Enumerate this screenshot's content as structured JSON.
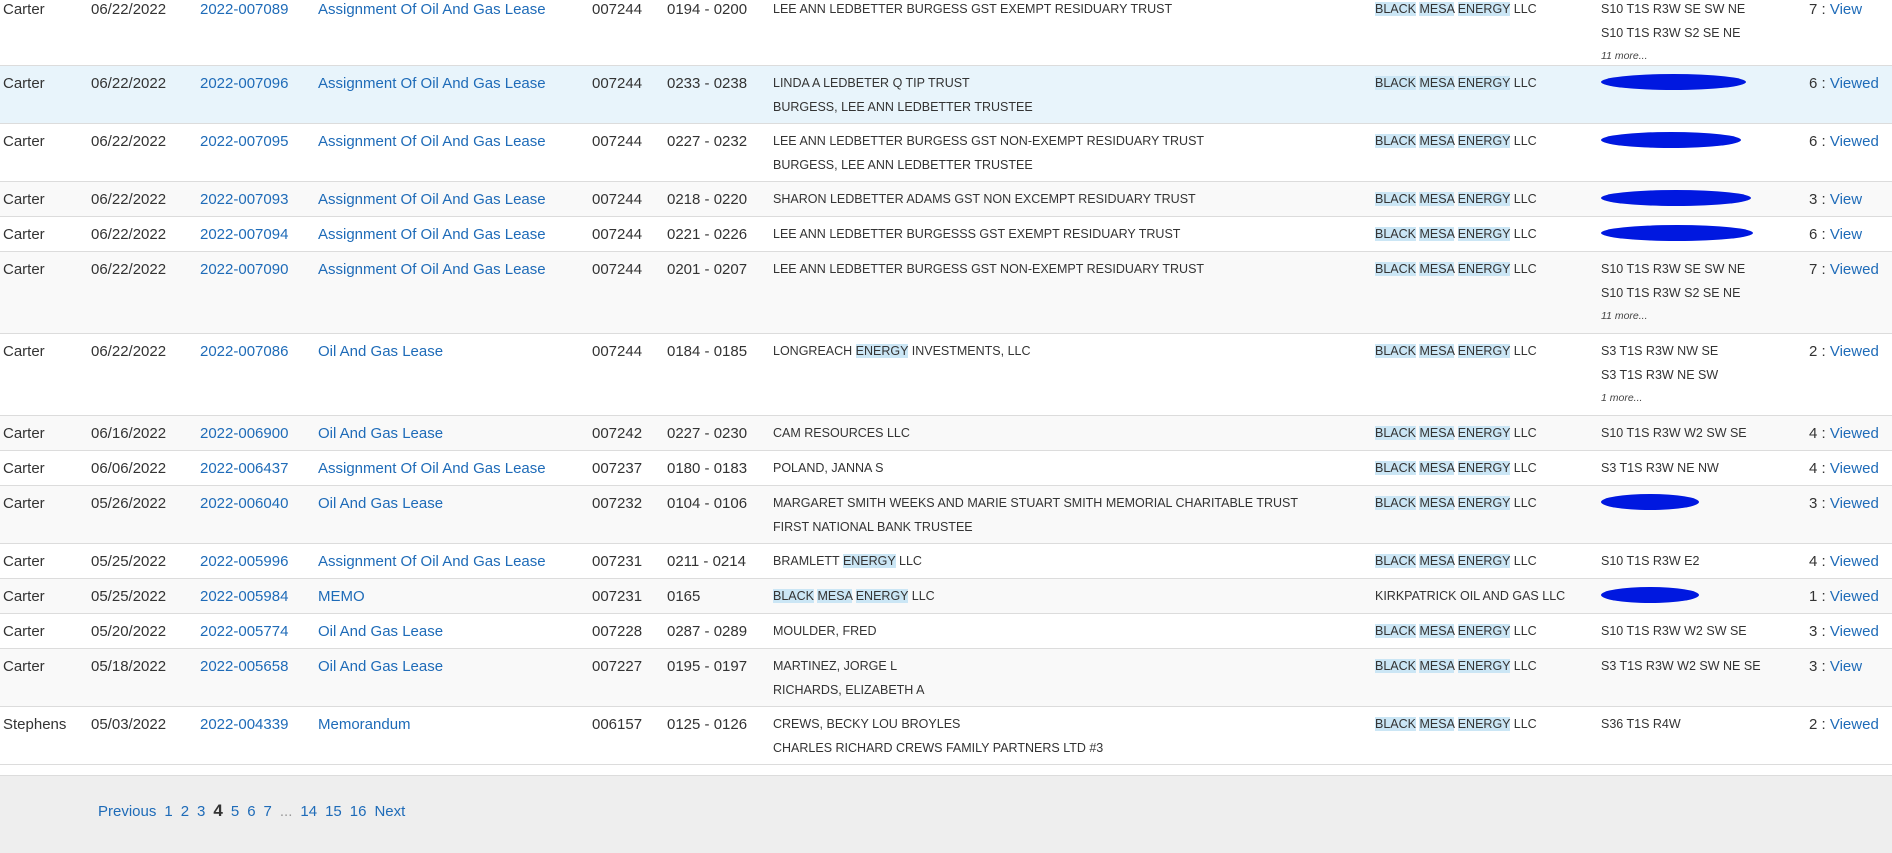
{
  "rows": [
    {
      "county": "Carter",
      "date": "06/22/2022",
      "doc": "2022-007089",
      "type": "Assignment Of Oil And Gas Lease",
      "book": "007244",
      "pages": "0194 - 0200",
      "grantor": [
        "LEE ANN LEDBETTER BURGESS GST EXEMPT RESIDUARY TRUST"
      ],
      "grantee": "BLACK MESA ENERGY LLC",
      "legal": [
        "S10 T1S R3W SE SW NE",
        "S10 T1S R3W S2 SE NE"
      ],
      "more": "11 more...",
      "views": "7 :",
      "view_link": "View",
      "style": "",
      "height": 73
    },
    {
      "county": "Carter",
      "date": "06/22/2022",
      "doc": "2022-007096",
      "type": "Assignment Of Oil And Gas Lease",
      "book": "007244",
      "pages": "0233 - 0238",
      "grantor": [
        "LINDA A LEDBETER Q TIP TRUST",
        "BURGESS, LEE ANN LEDBETTER TRUSTEE"
      ],
      "grantee": "BLACK MESA ENERGY LLC",
      "legal": [],
      "more": "",
      "views": "6 :",
      "view_link": "Viewed",
      "style": "hl",
      "height": 58
    },
    {
      "county": "Carter",
      "date": "06/22/2022",
      "doc": "2022-007095",
      "type": "Assignment Of Oil And Gas Lease",
      "book": "007244",
      "pages": "0227 - 0232",
      "grantor": [
        "LEE ANN LEDBETTER BURGESS GST NON-EXEMPT RESIDUARY TRUST",
        "BURGESS, LEE ANN LEDBETTER TRUSTEE"
      ],
      "grantee": "BLACK MESA ENERGY LLC",
      "legal": [],
      "more": "",
      "views": "6 :",
      "view_link": "Viewed",
      "style": "",
      "height": 58
    },
    {
      "county": "Carter",
      "date": "06/22/2022",
      "doc": "2022-007093",
      "type": "Assignment Of Oil And Gas Lease",
      "book": "007244",
      "pages": "0218 - 0220",
      "grantor": [
        "SHARON LEDBETTER ADAMS GST NON EXCEMPT RESIDUARY TRUST"
      ],
      "grantee": "BLACK MESA ENERGY LLC",
      "legal": [],
      "more": "",
      "views": "3 :",
      "view_link": "View",
      "style": "alt",
      "height": 35
    },
    {
      "county": "Carter",
      "date": "06/22/2022",
      "doc": "2022-007094",
      "type": "Assignment Of Oil And Gas Lease",
      "book": "007244",
      "pages": "0221 - 0226",
      "grantor": [
        "LEE ANN LEDBETTER BURGESSS GST EXEMPT RESIDUARY TRUST"
      ],
      "grantee": "BLACK MESA ENERGY LLC",
      "legal": [],
      "more": "",
      "views": "6 :",
      "view_link": "View",
      "style": "",
      "height": 35
    },
    {
      "county": "Carter",
      "date": "06/22/2022",
      "doc": "2022-007090",
      "type": "Assignment Of Oil And Gas Lease",
      "book": "007244",
      "pages": "0201 - 0207",
      "grantor": [
        "LEE ANN LEDBETTER BURGESS GST NON-EXEMPT RESIDUARY TRUST"
      ],
      "grantee": "BLACK MESA ENERGY LLC",
      "legal": [
        "S10 T1S R3W SE SW NE",
        "S10 T1S R3W S2 SE NE"
      ],
      "more": "11 more...",
      "views": "7 :",
      "view_link": "Viewed",
      "style": "alt",
      "height": 82
    },
    {
      "county": "Carter",
      "date": "06/22/2022",
      "doc": "2022-007086",
      "type": "Oil And Gas Lease",
      "book": "007244",
      "pages": "0184 - 0185",
      "grantor": [
        "LONGREACH ENERGY INVESTMENTS, LLC"
      ],
      "grantee": "BLACK MESA ENERGY LLC",
      "legal": [
        "S3 T1S R3W NW SE",
        "S3 T1S R3W NE SW"
      ],
      "more": "1 more...",
      "views": "2 :",
      "view_link": "Viewed",
      "style": "",
      "height": 82
    },
    {
      "county": "Carter",
      "date": "06/16/2022",
      "doc": "2022-006900",
      "type": "Oil And Gas Lease",
      "book": "007242",
      "pages": "0227 - 0230",
      "grantor": [
        "CAM RESOURCES LLC"
      ],
      "grantee": "BLACK MESA ENERGY LLC",
      "legal": [
        "S10 T1S R3W W2 SW SE"
      ],
      "more": "",
      "views": "4 :",
      "view_link": "Viewed",
      "style": "alt",
      "height": 35
    },
    {
      "county": "Carter",
      "date": "06/06/2022",
      "doc": "2022-006437",
      "type": "Assignment Of Oil And Gas Lease",
      "book": "007237",
      "pages": "0180 - 0183",
      "grantor": [
        "POLAND, JANNA S"
      ],
      "grantee": "BLACK MESA ENERGY LLC",
      "legal": [
        "S3 T1S R3W NE NW"
      ],
      "more": "",
      "views": "4 :",
      "view_link": "Viewed",
      "style": "",
      "height": 35
    },
    {
      "county": "Carter",
      "date": "05/26/2022",
      "doc": "2022-006040",
      "type": "Oil And Gas Lease",
      "book": "007232",
      "pages": "0104 - 0106",
      "grantor": [
        "MARGARET SMITH WEEKS AND MARIE STUART SMITH MEMORIAL CHARITABLE TRUST",
        "FIRST NATIONAL BANK TRUSTEE"
      ],
      "grantee": "BLACK MESA ENERGY LLC",
      "legal": [],
      "more": "",
      "views": "3 :",
      "view_link": "Viewed",
      "style": "alt",
      "height": 58
    },
    {
      "county": "Carter",
      "date": "05/25/2022",
      "doc": "2022-005996",
      "type": "Assignment Of Oil And Gas Lease",
      "book": "007231",
      "pages": "0211 - 0214",
      "grantor": [
        "BRAMLETT ENERGY LLC"
      ],
      "grantee": "BLACK MESA ENERGY LLC",
      "legal": [
        "S10 T1S R3W E2"
      ],
      "more": "",
      "views": "4 :",
      "view_link": "Viewed",
      "style": "",
      "height": 35
    },
    {
      "county": "Carter",
      "date": "05/25/2022",
      "doc": "2022-005984",
      "type": "MEMO",
      "book": "007231",
      "pages": "0165",
      "grantor": [
        "BLACK MESA ENERGY LLC"
      ],
      "grantee": "KIRKPATRICK OIL AND GAS LLC",
      "legal": [],
      "more": "",
      "views": "1 :",
      "view_link": "Viewed",
      "style": "alt",
      "height": 35
    },
    {
      "county": "Carter",
      "date": "05/20/2022",
      "doc": "2022-005774",
      "type": "Oil And Gas Lease",
      "book": "007228",
      "pages": "0287 - 0289",
      "grantor": [
        "MOULDER, FRED"
      ],
      "grantee": "BLACK MESA ENERGY LLC",
      "legal": [
        "S10 T1S R3W W2 SW SE"
      ],
      "more": "",
      "views": "3 :",
      "view_link": "Viewed",
      "style": "",
      "height": 35
    },
    {
      "county": "Carter",
      "date": "05/18/2022",
      "doc": "2022-005658",
      "type": "Oil And Gas Lease",
      "book": "007227",
      "pages": "0195 - 0197",
      "grantor": [
        "MARTINEZ, JORGE L",
        "RICHARDS, ELIZABETH A"
      ],
      "grantee": "BLACK MESA ENERGY LLC",
      "legal": [
        "S3 T1S R3W W2 SW NE SE"
      ],
      "more": "",
      "views": "3 :",
      "view_link": "View",
      "style": "alt",
      "height": 58
    },
    {
      "county": "Stephens",
      "date": "05/03/2022",
      "doc": "2022-004339",
      "type": "Memorandum",
      "book": "006157",
      "pages": "0125 - 0126",
      "grantor": [
        "CREWS, BECKY LOU BROYLES",
        "CHARLES RICHARD CREWS FAMILY PARTNERS LTD #3"
      ],
      "grantee": "BLACK MESA ENERGY LLC",
      "legal": [
        "S36 T1S R4W"
      ],
      "more": "",
      "views": "2 :",
      "view_link": "Viewed",
      "style": "",
      "height": 58
    }
  ],
  "highlight_words": [
    "BLACK",
    "MESA",
    "ENERGY"
  ],
  "redactions": [
    1,
    2,
    3,
    4,
    9,
    11
  ],
  "pager": {
    "previous": "Previous",
    "pages": [
      "1",
      "2",
      "3",
      "4",
      "5",
      "6",
      "7",
      "...",
      "14",
      "15",
      "16"
    ],
    "current": "4",
    "next": "Next"
  }
}
